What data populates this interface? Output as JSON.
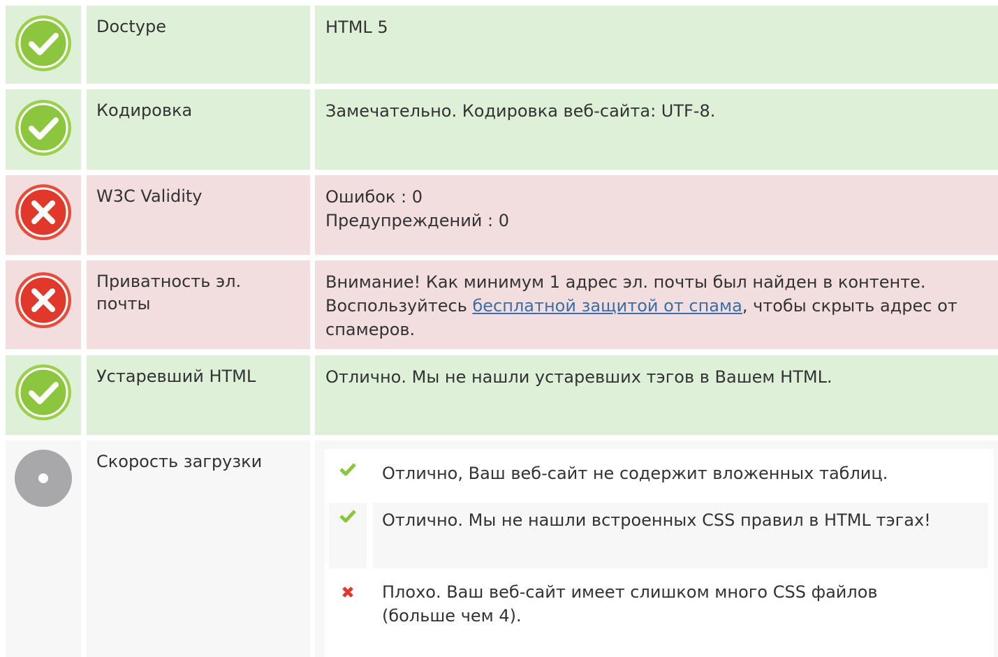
{
  "colors": {
    "pass_bg": "#dff0d8",
    "fail_bg": "#f2dede",
    "info_bg": "#f7f7f7",
    "pass_icon": "#8cc63f",
    "fail_icon": "#e74c3c",
    "info_icon": "#a8a8aa",
    "link": "#3a6ea5"
  },
  "rows": [
    {
      "status": "pass",
      "icon": "check-circle-icon",
      "label": "Doctype",
      "value": "HTML 5"
    },
    {
      "status": "pass",
      "icon": "check-circle-icon",
      "label": "Кодировка",
      "value": "Замечательно. Кодировка веб-сайта: UTF-8."
    },
    {
      "status": "fail",
      "icon": "x-circle-icon",
      "label": "W3C Validity",
      "errors": "Ошибок : 0",
      "warnings": "Предупреждений : 0"
    },
    {
      "status": "fail",
      "icon": "x-circle-icon",
      "label": "Приватность эл. почты",
      "value_before": "Внимание! Как минимум 1 адрес эл. почты был найден в контенте. Воспользуйтесь ",
      "link_text": "бесплатной защитой от спама",
      "value_after": ", чтобы скрыть адрес от спамеров."
    },
    {
      "status": "pass",
      "icon": "check-circle-icon",
      "label": "Устаревший HTML",
      "value": "Отлично. Мы не нашли устаревших тэгов в Вашем HTML."
    },
    {
      "status": "info",
      "icon": "info-circle-icon",
      "label": "Скорость загрузки",
      "items": [
        {
          "status": "pass",
          "icon": "check-mark-icon",
          "text": "Отлично, Ваш веб-сайт не содержит вложенных таблиц."
        },
        {
          "status": "pass",
          "icon": "check-mark-icon",
          "text": "Отлично. Мы не нашли встроенных CSS правил в HTML тэгах!"
        },
        {
          "status": "fail",
          "icon": "cross-mark-icon",
          "text": "Плохо. Ваш веб-сайт имеет слишком много CSS файлов (больше чем 4)."
        }
      ]
    }
  ]
}
